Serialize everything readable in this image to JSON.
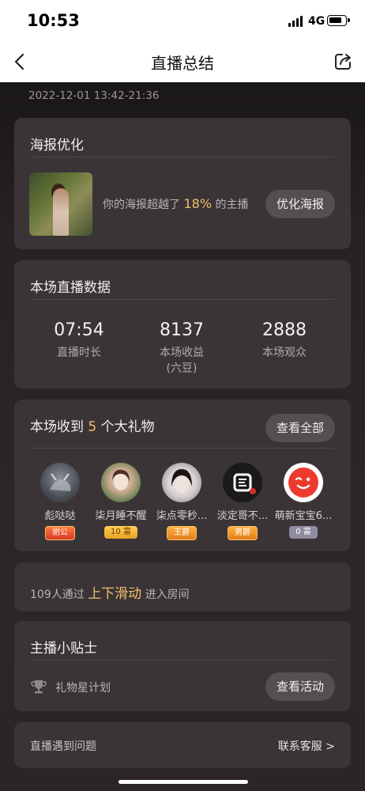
{
  "status": {
    "time": "10:53",
    "network": "4G"
  },
  "nav": {
    "title": "直播总结"
  },
  "date": "2022-12-01 13:42-21:36",
  "poster": {
    "title": "海报优化",
    "text_before": "你的海报超越了",
    "percent": "18%",
    "text_after": "的主播",
    "button": "优化海报"
  },
  "stats": {
    "title": "本场直播数据",
    "items": [
      {
        "value": "07:54",
        "label": "直播时长"
      },
      {
        "value": "8137",
        "label": "本场收益",
        "sub": "(六豆)"
      },
      {
        "value": "2888",
        "label": "本场观众"
      }
    ]
  },
  "gifts": {
    "title_before": "本场收到",
    "count": "5",
    "title_after": "个大礼物",
    "button": "查看全部",
    "items": [
      {
        "name": "彪哒哒",
        "badge": "驸公"
      },
      {
        "name": "柒月睡不醒",
        "badge": "10 富"
      },
      {
        "name": "柒点零秒...",
        "badge": "王爵"
      },
      {
        "name": "淡定哥不...",
        "badge": "男爵"
      },
      {
        "name": "萌新宝宝6...",
        "badge": "0 富"
      }
    ]
  },
  "swipe": {
    "prefix": "109人通过",
    "highlight": "上下滑动",
    "suffix": "进入房间"
  },
  "tips": {
    "title": "主播小贴士",
    "item": "礼物星计划",
    "button": "查看活动"
  },
  "help": {
    "left": "直播遇到问题",
    "right": "联系客服 >"
  },
  "colors": {
    "highlight": "#f2c06a",
    "card": "#3a3437",
    "button": "#55504f"
  }
}
